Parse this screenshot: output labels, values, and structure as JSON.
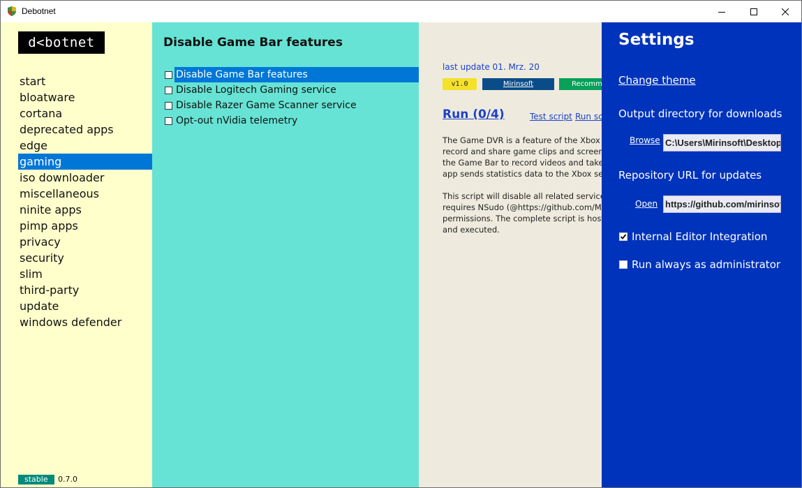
{
  "window": {
    "title": "Debotnet",
    "controls": {
      "minimize_icon": "minimize-icon",
      "maximize_icon": "maximize-icon",
      "close_icon": "close-icon"
    }
  },
  "colors": {
    "nav_bg": "#ffffcc",
    "list_bg": "#66e3d5",
    "detail_bg": "#eeebde",
    "settings_bg": "#0033bb",
    "selection": "#0077d7",
    "link": "#1c3fcc"
  },
  "sidebar": {
    "logo": "d<botnet",
    "items": [
      {
        "label": "start",
        "selected": false
      },
      {
        "label": "bloatware",
        "selected": false
      },
      {
        "label": "cortana",
        "selected": false
      },
      {
        "label": "deprecated apps",
        "selected": false
      },
      {
        "label": "edge",
        "selected": false
      },
      {
        "label": "gaming",
        "selected": true
      },
      {
        "label": "iso downloader",
        "selected": false
      },
      {
        "label": "miscellaneous",
        "selected": false
      },
      {
        "label": "ninite apps",
        "selected": false
      },
      {
        "label": "pimp apps",
        "selected": false
      },
      {
        "label": "privacy",
        "selected": false
      },
      {
        "label": "security",
        "selected": false
      },
      {
        "label": "slim",
        "selected": false
      },
      {
        "label": "third-party",
        "selected": false
      },
      {
        "label": "update",
        "selected": false
      },
      {
        "label": "windows defender",
        "selected": false
      }
    ],
    "channel_badge": "stable",
    "version": "0.7.0"
  },
  "script_list": {
    "title": "Disable Game Bar features",
    "items": [
      {
        "label": "Disable Game Bar features",
        "checked": false,
        "selected": true
      },
      {
        "label": "Disable Logitech Gaming service",
        "checked": false,
        "selected": false
      },
      {
        "label": "Disable Razer Game Scanner service",
        "checked": false,
        "selected": false
      },
      {
        "label": "Opt-out nVidia telemetry",
        "checked": false,
        "selected": false
      }
    ]
  },
  "details": {
    "last_update": "last update 01. Mrz. 20",
    "tag_version": "v1.0",
    "tag_author": "Mirinsoft",
    "tag_recommended": "Recomme",
    "run_link": "Run (0/4)",
    "test_script_link": "Test script",
    "run_script_link": "Run scr",
    "description": "The Game DVR is a feature of the Xbox a\nrecord and share game clips and screens\nthe Game Bar to record videos and take\napp sends statistics data to the Xbox serv\n\nThis script will disable all related services\nrequires NSudo (@https://github.com/M2\npermissions. The complete script is hoste\nand executed."
  },
  "settings": {
    "title": "Settings",
    "change_theme": "Change theme",
    "output_dir_label": "Output directory for downloads",
    "browse_link": "Browse",
    "output_dir_value": "C:\\Users\\Mirinsoft\\Desktop\\",
    "repo_url_label": "Repository URL for updates",
    "open_link": "Open",
    "repo_url_value": "https://github.com/mirinsoft",
    "editor_integration": {
      "label": "Internal Editor Integration",
      "checked": true
    },
    "run_as_admin": {
      "label": "Run always as administrator",
      "checked": false
    }
  }
}
